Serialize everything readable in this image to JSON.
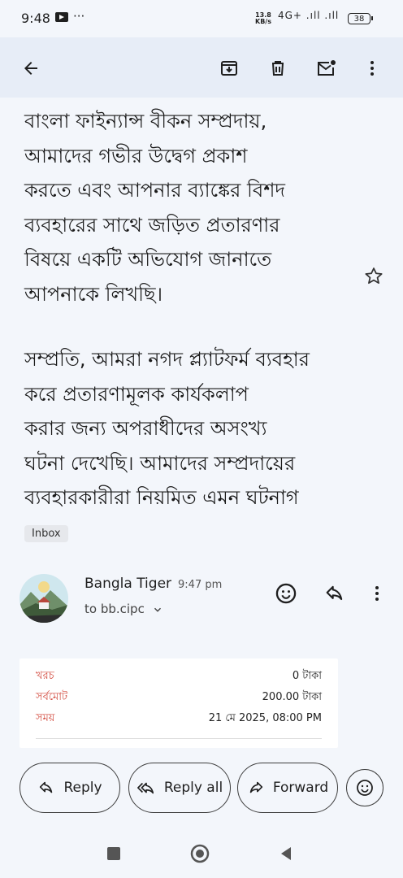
{
  "status": {
    "time": "9:48",
    "speed_value": "13.8",
    "speed_unit": "KB/s",
    "icons": "4G+ .ıll .ıll",
    "battery": "38"
  },
  "email": {
    "paragraph1_lines": [
      "বাংলা ফাইন্যান্স বীকন সম্প্রদায়,",
      "আমাদের গভীর উদ্বেগ প্রকাশ",
      "করতে এবং আপনার ব্যাঙ্কের বিশদ",
      "ব্যবহারের সাথে জড়িত প্রতারণার",
      "বিষয়ে একটি অভিযোগ জানাতে",
      "আপনাকে লিখছি।"
    ],
    "paragraph2_lines": [
      "সম্প্রতি, আমরা নগদ প্ল্যাটফর্ম ব্যবহার",
      "করে প্রতারণামূলক কার্যকলাপ",
      "করার জন্য অপরাধীদের অসংখ্য",
      "ঘটনা দেখেছি। আমাদের সম্প্রদায়ের",
      "ব্যবহারকারীরা নিয়মিত এমন ঘটনাগ"
    ],
    "label_chip": "Inbox"
  },
  "message": {
    "sender_name": "Bangla Tiger",
    "time": "9:47 pm",
    "to": "to bb.cipc"
  },
  "receipt": {
    "rows": [
      {
        "label": "খরচ",
        "value": "0 টাকা"
      },
      {
        "label": "সর্বমোট",
        "value": "200.00 টাকা"
      },
      {
        "label": "সময়",
        "value": "21 মে 2025, 08:00 PM"
      }
    ]
  },
  "actions": {
    "reply": "Reply",
    "reply_all": "Reply all",
    "forward": "Forward"
  },
  "icons": {
    "back": "arrow-left-icon",
    "archive": "archive-icon",
    "delete": "trash-icon",
    "unread": "mark-unread-icon",
    "more": "more-vert-icon",
    "star": "star-icon",
    "emoji": "smiley-icon"
  },
  "colors": {
    "receipt_label": "#d34b3f",
    "top_bar": "#e7edf7",
    "background": "#f3f6fb"
  }
}
